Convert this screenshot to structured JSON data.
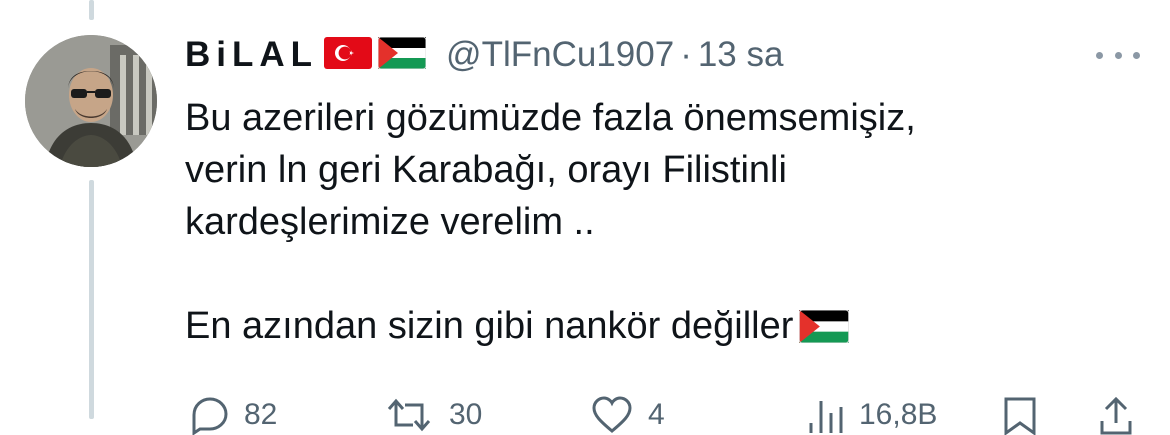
{
  "tweet": {
    "display_name": "BiLAL",
    "name_flags": [
      "turkey-flag-icon",
      "palestine-flag-icon"
    ],
    "handle": "@TlFnCu1907",
    "separator": "·",
    "time": "13 sa",
    "body_lines": [
      "Bu azerileri gözümüzde fazla önemsemişiz,",
      "verin ln geri Karabağı, orayı Filistinli",
      "kardeşlerimize verelim .."
    ],
    "closing_line": "En azından sizin gibi nankör değiller",
    "closing_emoji": "palestine-flag-icon",
    "actions": {
      "reply_count": "82",
      "retweet_count": "30",
      "like_count": "4",
      "views_count": "16,8B"
    }
  },
  "colors": {
    "text_primary": "#0f1419",
    "text_secondary": "#536471",
    "thread_line": "#cfd9de",
    "turkey_red": "#e30a17",
    "palestine_green": "#149954",
    "palestine_red": "#e4312b"
  }
}
